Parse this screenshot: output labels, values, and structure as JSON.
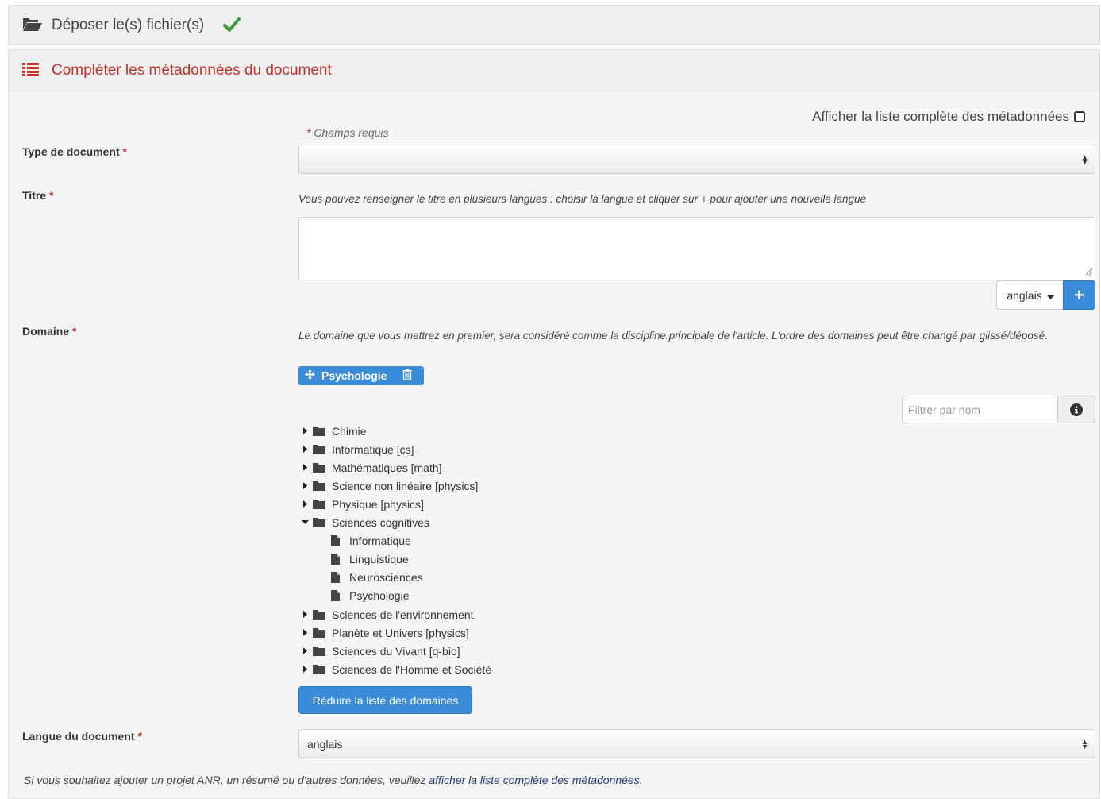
{
  "deposit_panel": {
    "title": "Déposer le(s) fichier(s)",
    "icon": "folder-open-icon",
    "status_icon": "check-icon"
  },
  "meta_panel": {
    "title": "Compléter les métadonnées du document",
    "icon": "list-icon"
  },
  "toggle_full_list": {
    "label": "Afficher la liste complète des métadonnées",
    "checked": false
  },
  "required_note": "Champs requis",
  "fields": {
    "doc_type": {
      "label": "Type de document",
      "required_mark": "*",
      "value": ""
    },
    "title": {
      "label": "Titre",
      "required_mark": "*",
      "help": "Vous pouvez renseigner le titre en plusieurs langues : choisir la langue et cliquer sur + pour ajouter une nouvelle langue",
      "value": "",
      "language": "anglais",
      "add_label": "+"
    },
    "domain": {
      "label": "Domaine",
      "required_mark": "*",
      "help": "Le domaine que vous mettrez en premier, sera considéré comme la discipline principale de l'article. L'ordre des domaines peut être changé par glissé/déposé.",
      "selected_tag": "Psychologie",
      "filter_placeholder": "Filtrer par nom",
      "tree": [
        {
          "label": "Chimie",
          "expanded": false
        },
        {
          "label": "Informatique [cs]",
          "expanded": false
        },
        {
          "label": "Mathématiques [math]",
          "expanded": false
        },
        {
          "label": "Science non linéaire [physics]",
          "expanded": false
        },
        {
          "label": "Physique [physics]",
          "expanded": false
        },
        {
          "label": "Sciences cognitives",
          "expanded": true,
          "children": [
            "Informatique",
            "Linguistique",
            "Neurosciences",
            "Psychologie"
          ]
        },
        {
          "label": "Sciences de l'environnement",
          "expanded": false
        },
        {
          "label": "Planète et Univers [physics]",
          "expanded": false
        },
        {
          "label": "Sciences du Vivant [q-bio]",
          "expanded": false
        },
        {
          "label": "Sciences de l'Homme et Société",
          "expanded": false
        }
      ],
      "reduce_button": "Réduire la liste des domaines"
    },
    "language": {
      "label": "Langue du document",
      "required_mark": "*",
      "value": "anglais"
    }
  },
  "footnote": {
    "text": "Si vous souhaitez ajouter un projet ANR, un résumé ou d'autres données, veuillez ",
    "link": "afficher la liste complète des métadonnées",
    "end": "."
  },
  "colors": {
    "accent_blue": "#3a8bd8",
    "required_red": "#c9302c",
    "check_green": "#3c9a3c",
    "link": "#1f3a7a"
  }
}
